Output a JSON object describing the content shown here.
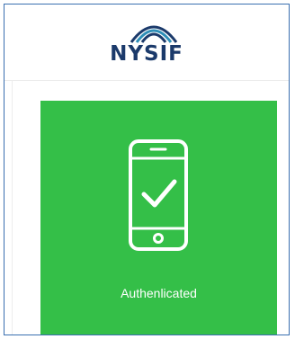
{
  "logo": {
    "text": "NYSIF",
    "icon": "nysif-arcs-logo"
  },
  "auth_card": {
    "status_label": "Authenlicated",
    "icon": "smartphone-check-icon"
  },
  "colors": {
    "card_green": "#34bf48",
    "logo_navy": "#1b3a6b",
    "frame_border": "#3a6fb0"
  }
}
